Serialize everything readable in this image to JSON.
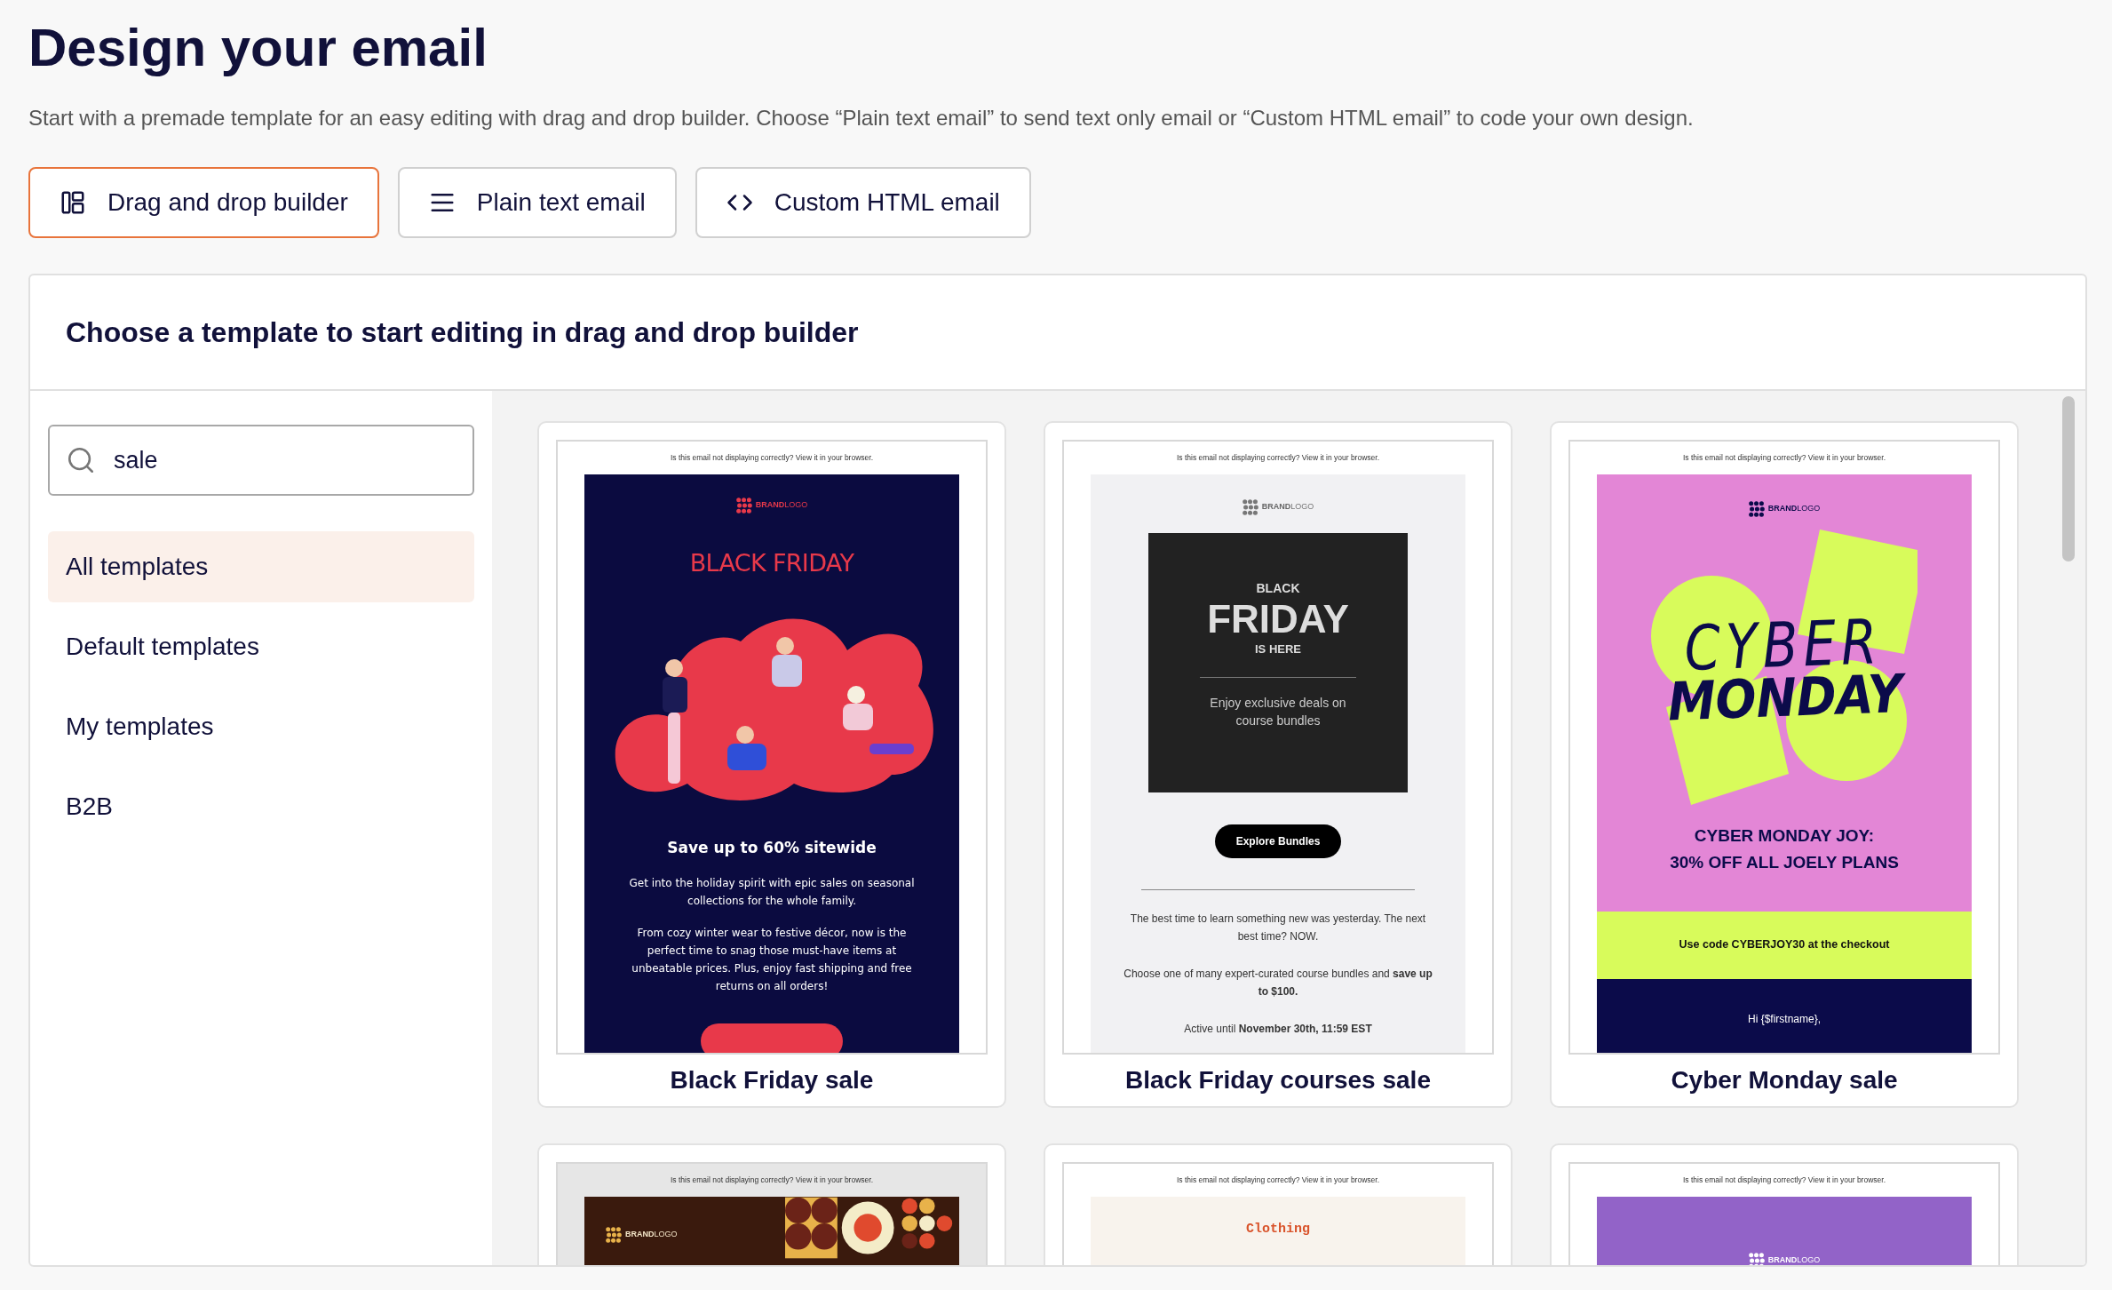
{
  "page": {
    "title": "Design your email",
    "subtitle": "Start with a premade template for an easy editing with drag and drop builder. Choose “Plain text email” to send text only email or “Custom HTML email” to code your own design."
  },
  "modes": [
    {
      "label": "Drag and drop builder",
      "kind": "layout",
      "selected": true
    },
    {
      "label": "Plain text email",
      "kind": "text",
      "selected": false
    },
    {
      "label": "Custom HTML email",
      "kind": "code",
      "selected": false
    }
  ],
  "panel": {
    "title": "Choose a template to start editing in drag and drop builder"
  },
  "search": {
    "value": "sale"
  },
  "categories": [
    {
      "label": "All templates",
      "selected": true
    },
    {
      "label": "Default templates",
      "selected": false
    },
    {
      "label": "My templates",
      "selected": false
    },
    {
      "label": "B2B",
      "selected": false
    }
  ],
  "templates": [
    {
      "kind": "black-friday",
      "name": "Black Friday sale",
      "notice": "Is this email not displaying correctly? View it in your browser.",
      "logo": {
        "strong": "BRAND",
        "light": "LOGO"
      },
      "heading": "BLACK FRIDAY",
      "subheading": "Save up to 60% sitewide",
      "paragraphs": [
        "Get into the holiday spirit with epic sales on seasonal collections for the whole family.",
        "From cozy winter wear to festive décor, now is the perfect time to snag those must-have items at unbeatable prices. Plus, enjoy fast shipping and free returns on all orders!"
      ]
    },
    {
      "kind": "courses",
      "name": "Black Friday courses sale",
      "notice": "Is this email not displaying correctly? View it in your browser.",
      "logo": {
        "strong": "BRAND",
        "light": "LOGO"
      },
      "kicker": "BLACK",
      "headline": "FRIDAY",
      "tag": "IS HERE",
      "deal": "Enjoy exclusive deals on course bundles",
      "button": "Explore Bundles",
      "paragraphs": [
        "The best time to learn something new was yesterday. The next best time? NOW.",
        "Choose one of many expert-curated course bundles and **save up to $100.**",
        "Active until **November 30th, 11:59 EST**"
      ]
    },
    {
      "kind": "cyber-monday",
      "name": "Cyber Monday sale",
      "notice": "Is this email not displaying correctly? View it in your browser.",
      "logo": {
        "strong": "BRAND",
        "light": "LOGO"
      },
      "title_lines": [
        "CYBER",
        "MONDAY"
      ],
      "headline": [
        "CYBER MONDAY JOY:",
        "30% OFF ALL JOELY PLANS"
      ],
      "code": "Use code CYBERJOY30 at the checkout",
      "greeting": "Hi {$firstname},"
    },
    {
      "kind": "geometric",
      "notice": "Is this email not displaying correctly? View it in your browser.",
      "logo": {
        "strong": "BRAND",
        "light": "LOGO"
      }
    },
    {
      "kind": "clothing",
      "notice": "Is this email not displaying correctly? View it in your browser.",
      "heading": "Clothing"
    },
    {
      "kind": "purple",
      "notice": "Is this email not displaying correctly? View it in your browser.",
      "logo": {
        "strong": "BRAND",
        "light": "LOGO"
      }
    }
  ]
}
